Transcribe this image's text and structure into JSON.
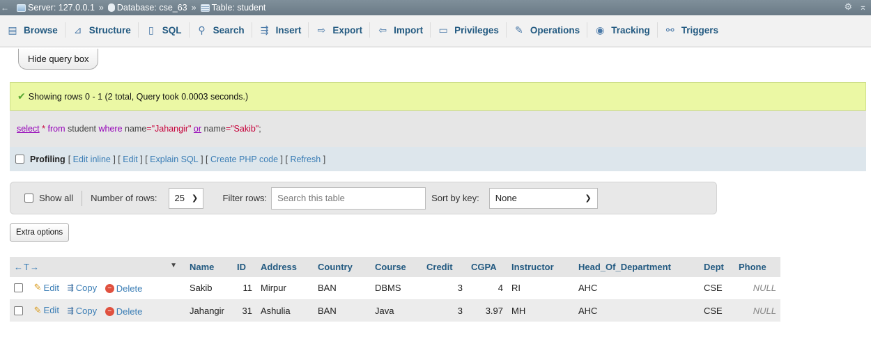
{
  "breadcrumb": {
    "back": "←",
    "server": "Server: 127.0.0.1",
    "database": "Database: cse_63",
    "table": "Table: student",
    "separator": "»"
  },
  "tabs": [
    {
      "label": "Browse",
      "icon": "browse-icon"
    },
    {
      "label": "Structure",
      "icon": "structure-icon"
    },
    {
      "label": "SQL",
      "icon": "sql-icon"
    },
    {
      "label": "Search",
      "icon": "search-icon"
    },
    {
      "label": "Insert",
      "icon": "insert-icon"
    },
    {
      "label": "Export",
      "icon": "export-icon"
    },
    {
      "label": "Import",
      "icon": "import-icon"
    },
    {
      "label": "Privileges",
      "icon": "privileges-icon"
    },
    {
      "label": "Operations",
      "icon": "operations-icon"
    },
    {
      "label": "Tracking",
      "icon": "tracking-icon"
    },
    {
      "label": "Triggers",
      "icon": "triggers-icon"
    }
  ],
  "hide_query_box": "Hide query box",
  "message": "Showing rows 0 - 1 (2 total, Query took 0.0003 seconds.)",
  "query": {
    "select": "select",
    "star": "*",
    "from": "from",
    "table": "student",
    "where": "where",
    "col1": "name",
    "eq1": "=",
    "val1": "\"Jahangir\"",
    "or": "or",
    "col2": "name",
    "eq2": "=",
    "val2": "\"Sakib\"",
    "end": ";"
  },
  "profiling": {
    "label": "Profiling",
    "links": [
      "Edit inline",
      "Edit",
      "Explain SQL",
      "Create PHP code",
      "Refresh"
    ]
  },
  "nav": {
    "show_all": "Show all",
    "rows_label": "Number of rows:",
    "rows_value": "25",
    "filter_label": "Filter rows:",
    "filter_placeholder": "Search this table",
    "sort_label": "Sort by key:",
    "sort_value": "None"
  },
  "extra_options": "Extra options",
  "table": {
    "arrows": "←T→",
    "columns": [
      "Name",
      "ID",
      "Address",
      "Country",
      "Course",
      "Credit",
      "CGPA",
      "Instructor",
      "Head_Of_Department",
      "Dept",
      "Phone"
    ],
    "actions": {
      "edit": "Edit",
      "copy": "Copy",
      "delete": "Delete"
    },
    "rows": [
      [
        "Sakib",
        "11",
        "Mirpur",
        "BAN",
        "DBMS",
        "3",
        "4",
        "RI",
        "AHC",
        "CSE",
        "NULL"
      ],
      [
        "Jahangir",
        "31",
        "Ashulia",
        "BAN",
        "Java",
        "3",
        "3.97",
        "MH",
        "AHC",
        "CSE",
        "NULL"
      ]
    ]
  },
  "colors": {
    "link": "#235a81",
    "success_bg": "#ebf8a4",
    "header_bar": "#7f8f9a"
  }
}
